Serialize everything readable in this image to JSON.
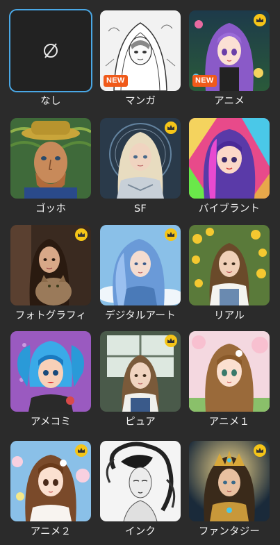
{
  "styles": [
    {
      "label": "なし",
      "premium": false,
      "badge": "",
      "selected": true,
      "icon": "none-icon"
    },
    {
      "label": "マンガ",
      "premium": false,
      "badge": "NEW",
      "selected": false,
      "icon": "manga-thumbnail"
    },
    {
      "label": "アニメ",
      "premium": true,
      "badge": "NEW",
      "selected": false,
      "icon": "anime-thumbnail"
    },
    {
      "label": "ゴッホ",
      "premium": false,
      "badge": "",
      "selected": false,
      "icon": "gogh-thumbnail"
    },
    {
      "label": "SF",
      "premium": true,
      "badge": "",
      "selected": false,
      "icon": "sf-thumbnail"
    },
    {
      "label": "バイブラント",
      "premium": false,
      "badge": "",
      "selected": false,
      "icon": "vibrant-thumbnail"
    },
    {
      "label": "フォトグラフィ",
      "premium": true,
      "badge": "",
      "selected": false,
      "icon": "photography-thumbnail"
    },
    {
      "label": "デジタルアート",
      "premium": true,
      "badge": "",
      "selected": false,
      "icon": "digital-art-thumbnail"
    },
    {
      "label": "リアル",
      "premium": false,
      "badge": "",
      "selected": false,
      "icon": "real-thumbnail"
    },
    {
      "label": "アメコミ",
      "premium": false,
      "badge": "",
      "selected": false,
      "icon": "american-comic-thumbnail"
    },
    {
      "label": "ピュア",
      "premium": true,
      "badge": "",
      "selected": false,
      "icon": "pure-thumbnail"
    },
    {
      "label": "アニメ１",
      "premium": false,
      "badge": "",
      "selected": false,
      "icon": "anime1-thumbnail"
    },
    {
      "label": "アニメ２",
      "premium": true,
      "badge": "",
      "selected": false,
      "icon": "anime2-thumbnail"
    },
    {
      "label": "インク",
      "premium": false,
      "badge": "",
      "selected": false,
      "icon": "ink-thumbnail"
    },
    {
      "label": "ファンタジー",
      "premium": true,
      "badge": "",
      "selected": false,
      "icon": "fantasy-thumbnail"
    }
  ],
  "colors": {
    "background": "#2b2b2b",
    "selected_border": "#4aa8e6",
    "crown": "#f5c518",
    "new_badge": "#f05a1a"
  }
}
